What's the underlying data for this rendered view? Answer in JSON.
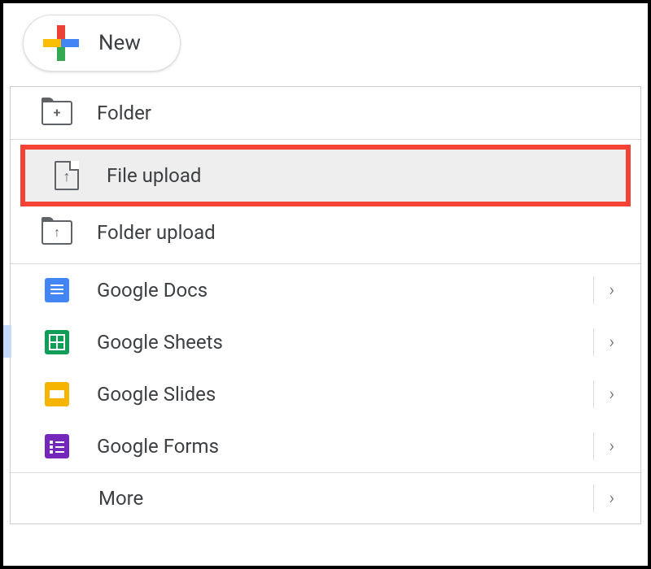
{
  "newButton": {
    "label": "New"
  },
  "menu": {
    "folder": "Folder",
    "fileUpload": "File upload",
    "folderUpload": "Folder upload",
    "docs": "Google Docs",
    "sheets": "Google Sheets",
    "slides": "Google Slides",
    "forms": "Google Forms",
    "more": "More"
  }
}
